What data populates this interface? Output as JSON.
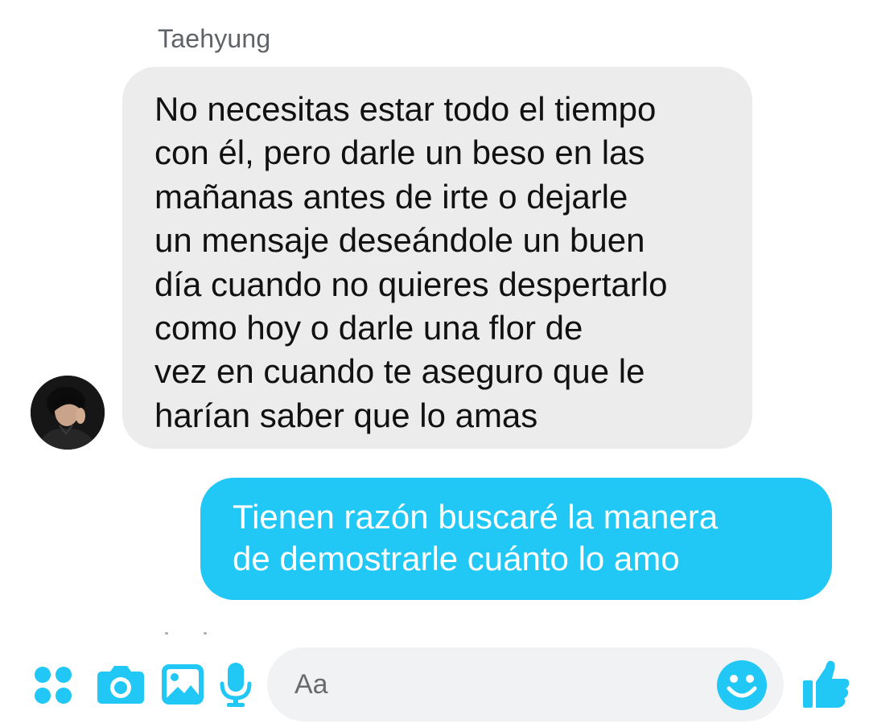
{
  "conversation": {
    "sender_name": "Taehyung",
    "incoming_message": "No necesitas estar todo el tiempo\ncon él, pero darle un beso en las\nmañanas antes de irte o dejarle\nun mensaje deseándole un buen\ndía cuando no quieres despertarlo\ncomo hoy o darle una flor de\nvez en cuando te aseguro que le\nharían saber que lo amas",
    "outgoing_message": "Tienen razón buscaré la manera\nde demostrarle cuánto lo amo"
  },
  "composer": {
    "placeholder": "Aa",
    "icons": [
      "apps-icon",
      "camera-icon",
      "image-icon",
      "mic-icon",
      "emoji-icon",
      "thumbs-up-icon"
    ]
  },
  "colors": {
    "accent": "#21c7f5",
    "incoming_bubble": "#ececec",
    "sender_name": "#5f6368"
  }
}
